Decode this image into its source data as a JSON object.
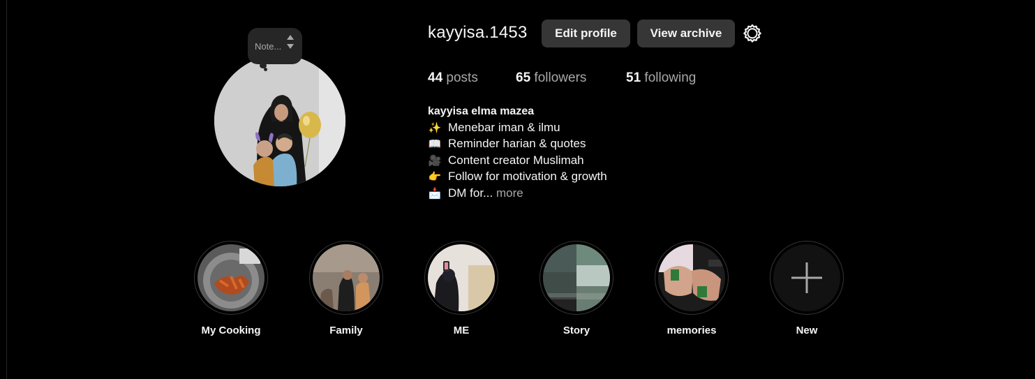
{
  "note": {
    "placeholder": "Note..."
  },
  "profile": {
    "username": "kayyisa.1453",
    "edit_label": "Edit profile",
    "archive_label": "View archive"
  },
  "stats": {
    "posts_count": "44",
    "posts_label": "posts",
    "followers_count": "65",
    "followers_label": "followers",
    "following_count": "51",
    "following_label": "following"
  },
  "bio": {
    "name": "kayyisa elma mazea",
    "lines": [
      {
        "emoji": "✨",
        "text": "Menebar iman & ilmu"
      },
      {
        "emoji": "📖",
        "text": "Reminder harian & quotes"
      },
      {
        "emoji": "🎥",
        "text": "Content creator Muslimah"
      },
      {
        "emoji": "👉",
        "text": "Follow for motivation & growth"
      },
      {
        "emoji": "📩",
        "text": "DM for..."
      }
    ],
    "more_label": "more"
  },
  "highlights": [
    {
      "label": "My Cooking"
    },
    {
      "label": "Family"
    },
    {
      "label": "ME"
    },
    {
      "label": "Story"
    },
    {
      "label": "memories"
    },
    {
      "label": "New"
    }
  ],
  "colors": {
    "background": "#000000",
    "button": "#363636",
    "secondary_text": "#a8a8a8",
    "primary_text": "#f5f5f5"
  },
  "icons": {
    "settings": "gear-icon",
    "add_highlight": "plus-icon"
  }
}
